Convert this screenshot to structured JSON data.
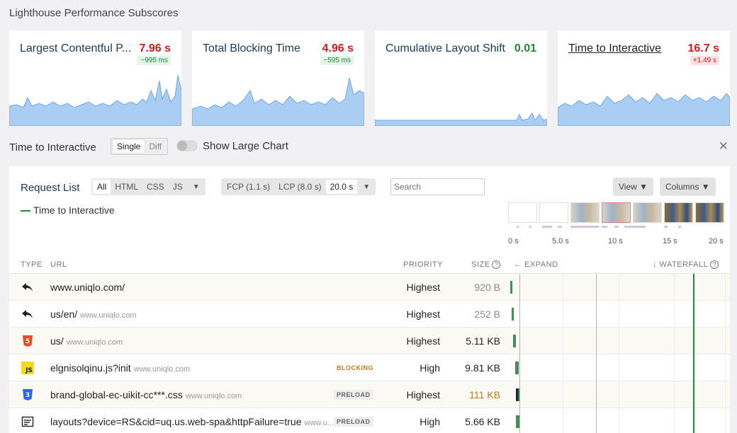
{
  "page_title": "Lighthouse Performance Subscores",
  "cards": [
    {
      "title": "Largest Contentful P...",
      "value": "7.96 s",
      "value_status": "bad",
      "delta": "−995 ms",
      "delta_status": "good",
      "underline": false
    },
    {
      "title": "Total Blocking Time",
      "value": "4.96 s",
      "value_status": "bad",
      "delta": "−595 ms",
      "delta_status": "good",
      "underline": false
    },
    {
      "title": "Cumulative Layout Shift",
      "value": "0.01",
      "value_status": "good",
      "delta": "",
      "delta_status": "",
      "underline": false
    },
    {
      "title": "Time to Interactive",
      "value": "16.7 s",
      "value_status": "bad",
      "delta": "+1.49 s",
      "delta_status": "bad",
      "underline": true
    }
  ],
  "tti_section": {
    "label": "Time to Interactive",
    "segments": [
      "Single",
      "Diff"
    ],
    "active_segment": "Single",
    "toggle_label": "Show Large Chart",
    "close_icon": "close-icon"
  },
  "request_list": {
    "title": "Request List",
    "type_filters": [
      "All",
      "HTML",
      "CSS",
      "JS"
    ],
    "active_type": "All",
    "time_filters": [
      "FCP (1.1 s)",
      "LCP (8.0 s)",
      "20.0 s"
    ],
    "active_time": "20.0 s",
    "search_placeholder": "Search",
    "view_label": "View",
    "columns_label": "Columns",
    "legend": "Time to Interactive",
    "axis_ticks": [
      "0 s",
      "5.0 s",
      "10 s",
      "15 s",
      "20 s"
    ],
    "headers": {
      "type": "TYPE",
      "url": "URL",
      "priority": "PRIORITY",
      "size": "SIZE",
      "expand": "← EXPAND",
      "waterfall": "↓ WATERFALL"
    },
    "rows": [
      {
        "type": "redirect",
        "url": "www.uniqlo.com/",
        "host": "",
        "badge": "",
        "priority": "Highest",
        "size": "920 B",
        "size_style": "muted"
      },
      {
        "type": "redirect",
        "url": "us/en/",
        "host": "www.uniqlo.com",
        "badge": "",
        "priority": "Highest",
        "size": "252 B",
        "size_style": "muted"
      },
      {
        "type": "html",
        "url": "us/",
        "host": "www.uniqlo.com",
        "badge": "",
        "priority": "Highest",
        "size": "5.11 KB",
        "size_style": "normal"
      },
      {
        "type": "js",
        "url": "elgnisolqinu.js?init",
        "host": "www.uniqlo.com",
        "badge": "BLOCKING",
        "priority": "High",
        "size": "9.81 KB",
        "size_style": "normal"
      },
      {
        "type": "css",
        "url": "brand-global-ec-uikit-cc***.css",
        "host": "www.uniqlo.com",
        "badge": "PRELOAD",
        "priority": "Highest",
        "size": "111 KB",
        "size_style": "warn"
      },
      {
        "type": "json",
        "url": "layouts?device=RS&cid=uq.us.web-spa&httpFailure=true",
        "host": "www.u...",
        "badge": "PRELOAD",
        "priority": "High",
        "size": "5.66 KB",
        "size_style": "normal"
      }
    ]
  },
  "colors": {
    "spark_fill": "#a9cdf3",
    "spark_stroke": "#6ea8e6",
    "tti_line": "#1f8a3a",
    "lcp_line": "#f0a0a0",
    "bar_green": "#4a8a5a"
  }
}
